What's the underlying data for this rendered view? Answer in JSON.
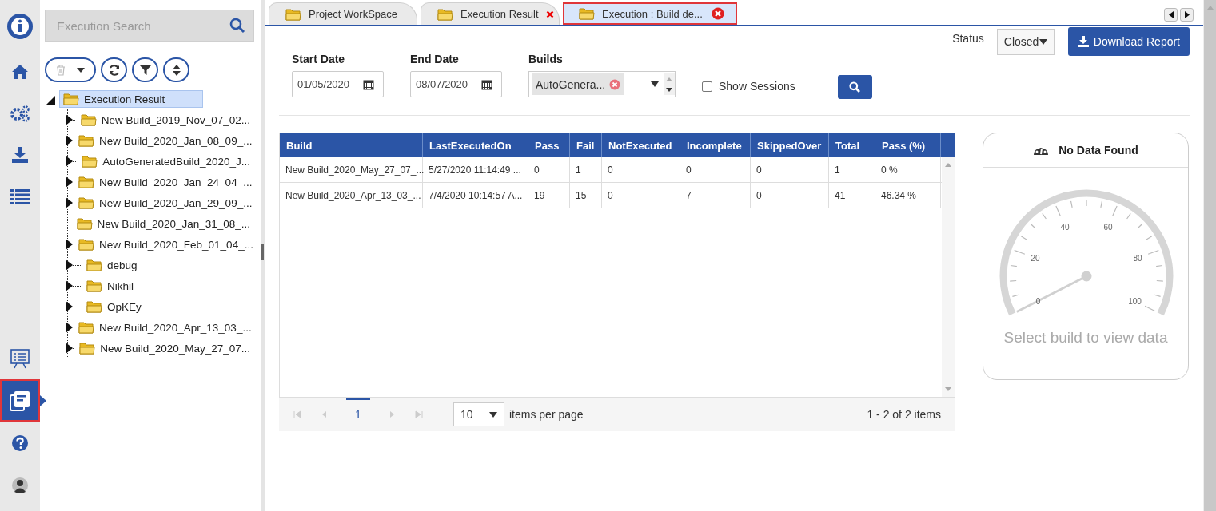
{
  "nav_top": [
    {
      "selected": false
    },
    {
      "selected": false
    },
    {
      "selected": false
    },
    {
      "selected": false
    },
    {
      "selected": false
    }
  ],
  "nav_bottom": [
    {
      "selected": false
    },
    {
      "selected": true
    },
    {
      "selected": false
    },
    {
      "selected": false
    }
  ],
  "search": {
    "placeholder": "Execution Search"
  },
  "tree": {
    "label": "Execution Result",
    "selected": true,
    "expanded": true,
    "children": [
      {
        "label": "New Build_2019_Nov_07_02...",
        "selected": false,
        "has_children": true
      },
      {
        "label": "New Build_2020_Jan_08_09_...",
        "selected": false,
        "has_children": true
      },
      {
        "label": "AutoGeneratedBuild_2020_J...",
        "selected": false,
        "has_children": true
      },
      {
        "label": "New Build_2020_Jan_24_04_...",
        "selected": false,
        "has_children": true
      },
      {
        "label": "New Build_2020_Jan_29_09_...",
        "selected": false,
        "has_children": true
      },
      {
        "label": "New Build_2020_Jan_31_08_...",
        "selected": false,
        "has_children": false
      },
      {
        "label": "New Build_2020_Feb_01_04_...",
        "selected": false,
        "has_children": true
      },
      {
        "label": "debug",
        "selected": false,
        "has_children": true
      },
      {
        "label": "Nikhil",
        "selected": false,
        "has_children": true
      },
      {
        "label": "OpKEy",
        "selected": false,
        "has_children": true
      },
      {
        "label": "New Build_2020_Apr_13_03_...",
        "selected": false,
        "has_children": true
      },
      {
        "label": "New Build_2020_May_27_07...",
        "selected": false,
        "has_children": true
      }
    ]
  },
  "tabs": [
    {
      "label": "Project WorkSpace",
      "selected": false,
      "closable": false
    },
    {
      "label": "Execution Result",
      "selected": false,
      "closable": true
    },
    {
      "label": "Execution : Build de...",
      "selected": true,
      "closable": true
    }
  ],
  "status": {
    "label": "Status",
    "value": "Closed"
  },
  "download_button": "Download Report",
  "filters": {
    "start_date": {
      "label": "Start Date",
      "value": "01/05/2020"
    },
    "end_date": {
      "label": "End Date",
      "value": "08/07/2020"
    },
    "builds": {
      "label": "Builds",
      "chips": [
        "AutoGenera..."
      ]
    },
    "show_sessions": {
      "label": "Show Sessions",
      "checked": false
    }
  },
  "table": {
    "columns": [
      "Build",
      "LastExecutedOn",
      "Pass",
      "Fail",
      "NotExecuted",
      "Incomplete",
      "SkippedOver",
      "Total",
      "Pass (%)"
    ],
    "rows": [
      [
        "New Build_2020_May_27_07_...",
        "5/27/2020 11:14:49 ...",
        "0",
        "1",
        "0",
        "0",
        "0",
        "1",
        "0 %"
      ],
      [
        "New Build_2020_Apr_13_03_...",
        "7/4/2020 10:14:57 A...",
        "19",
        "15",
        "0",
        "7",
        "0",
        "41",
        "46.34 %"
      ]
    ]
  },
  "pager": {
    "pages": [
      {
        "label": "1",
        "selected": true
      }
    ],
    "page_size": "10",
    "page_size_label": "items per page",
    "summary": "1 - 2 of 2 items"
  },
  "gauge": {
    "title": "No Data Found",
    "ticks": [
      "0",
      "20",
      "40",
      "60",
      "80",
      "100"
    ],
    "message": "Select build to view data"
  }
}
